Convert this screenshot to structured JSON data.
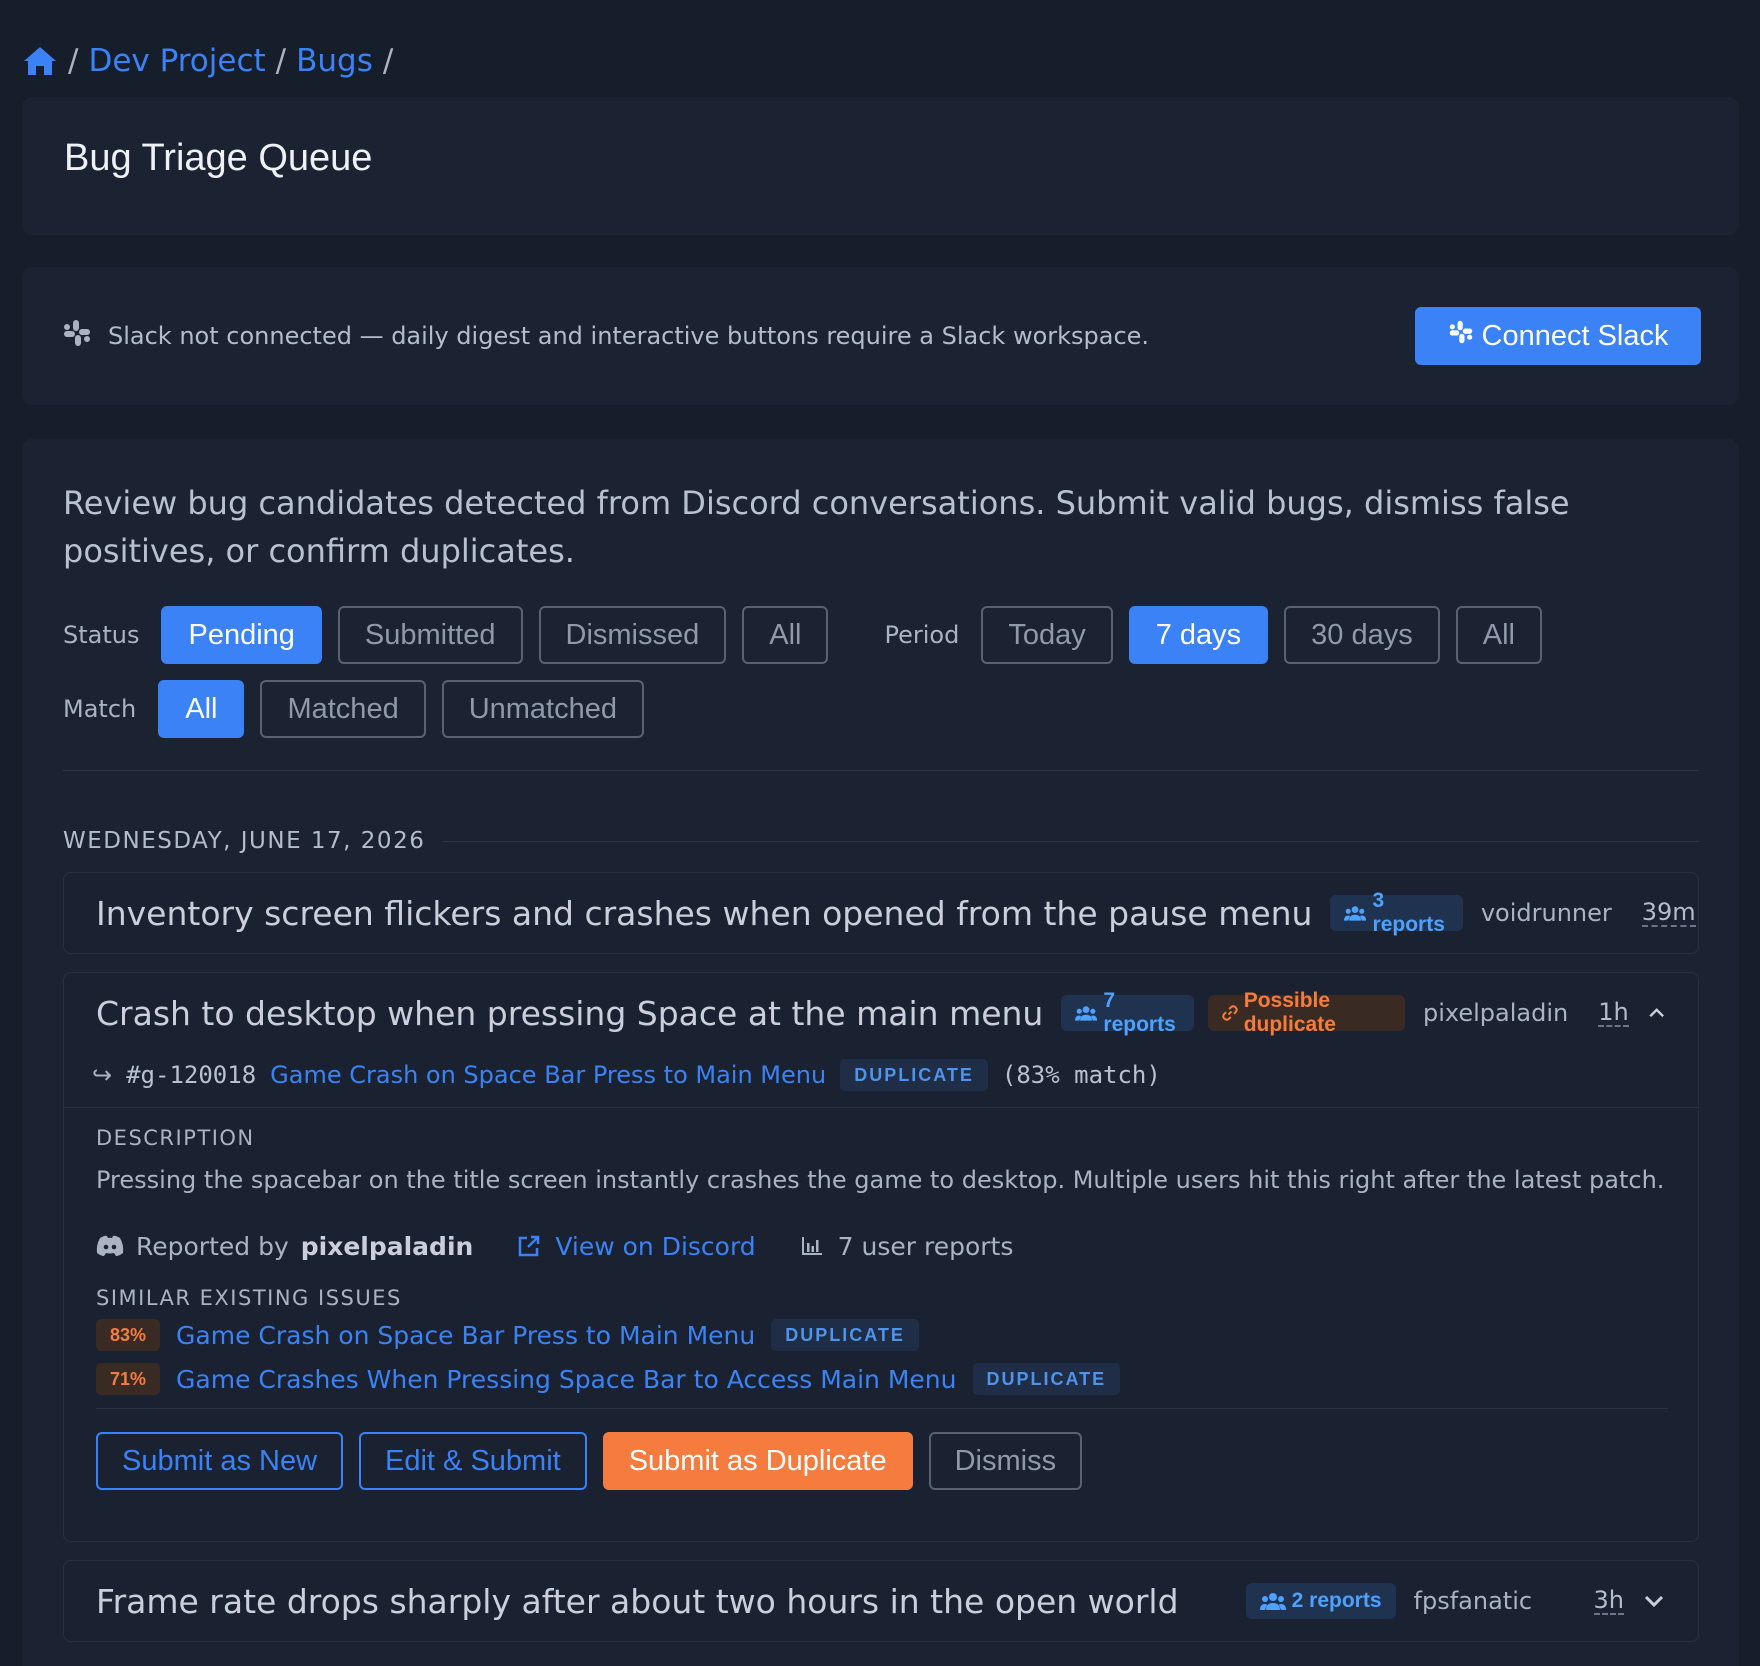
{
  "breadcrumb": {
    "items": [
      "Dev Project",
      "Bugs"
    ],
    "separator": "/"
  },
  "page_title": "Bug Triage Queue",
  "slack": {
    "message": "Slack not connected — daily digest and interactive buttons require a Slack workspace.",
    "button": "Connect Slack"
  },
  "intro": "Review bug candidates detected from Discord conversations. Submit valid bugs, dismiss false positives, or confirm duplicates.",
  "filters": {
    "status": {
      "label": "Status",
      "options": [
        "Pending",
        "Submitted",
        "Dismissed",
        "All"
      ],
      "selected": "Pending"
    },
    "period": {
      "label": "Period",
      "options": [
        "Today",
        "7 days",
        "30 days",
        "All"
      ],
      "selected": "7 days"
    },
    "match": {
      "label": "Match",
      "options": [
        "All",
        "Matched",
        "Unmatched"
      ],
      "selected": "All"
    }
  },
  "date_header": "WEDNESDAY, JUNE 17, 2026",
  "bugs": [
    {
      "title": "Inventory screen flickers and crashes when opened from the pause menu",
      "reports": "3 reports",
      "author": "voidrunner",
      "age": "39m"
    },
    {
      "title": "Crash to desktop when pressing Space at the main menu",
      "reports": "7 reports",
      "dup_badge": "Possible duplicate",
      "author": "pixelpaladin",
      "age": "1h",
      "match": {
        "id": "#g-120018",
        "title": "Game Crash on Space Bar Press to Main Menu",
        "tag": "DUPLICATE",
        "score": "(83% match)"
      },
      "description_label": "DESCRIPTION",
      "description": "Pressing the spacebar on the title screen instantly crashes the game to desktop. Multiple users hit this right after the latest patch.",
      "reported_by_prefix": "Reported by",
      "reported_by": "pixelpaladin",
      "view_link": "View on Discord",
      "user_reports": "7 user reports",
      "similar_label": "SIMILAR EXISTING ISSUES",
      "similar": [
        {
          "pct": "83%",
          "title": "Game Crash on Space Bar Press to Main Menu",
          "tag": "DUPLICATE"
        },
        {
          "pct": "71%",
          "title": "Game Crashes When Pressing Space Bar to Access Main Menu",
          "tag": "DUPLICATE"
        }
      ],
      "actions": [
        "Submit as New",
        "Edit & Submit",
        "Submit as Duplicate",
        "Dismiss"
      ]
    },
    {
      "title": "Frame rate drops sharply after about two hours in the open world",
      "reports": "2 reports",
      "author": "fpsfanatic",
      "age": "3h"
    }
  ],
  "colors": {
    "accent": "#3b82f6",
    "warning": "#f57c3e",
    "background": "#161d2b",
    "card": "#1b2333"
  },
  "icons": [
    "home-icon",
    "slack-icon",
    "users-icon",
    "link-icon",
    "chevron-down-icon",
    "chevron-up-icon",
    "discord-icon",
    "external-link-icon",
    "bar-chart-icon",
    "return-arrow-icon"
  ]
}
